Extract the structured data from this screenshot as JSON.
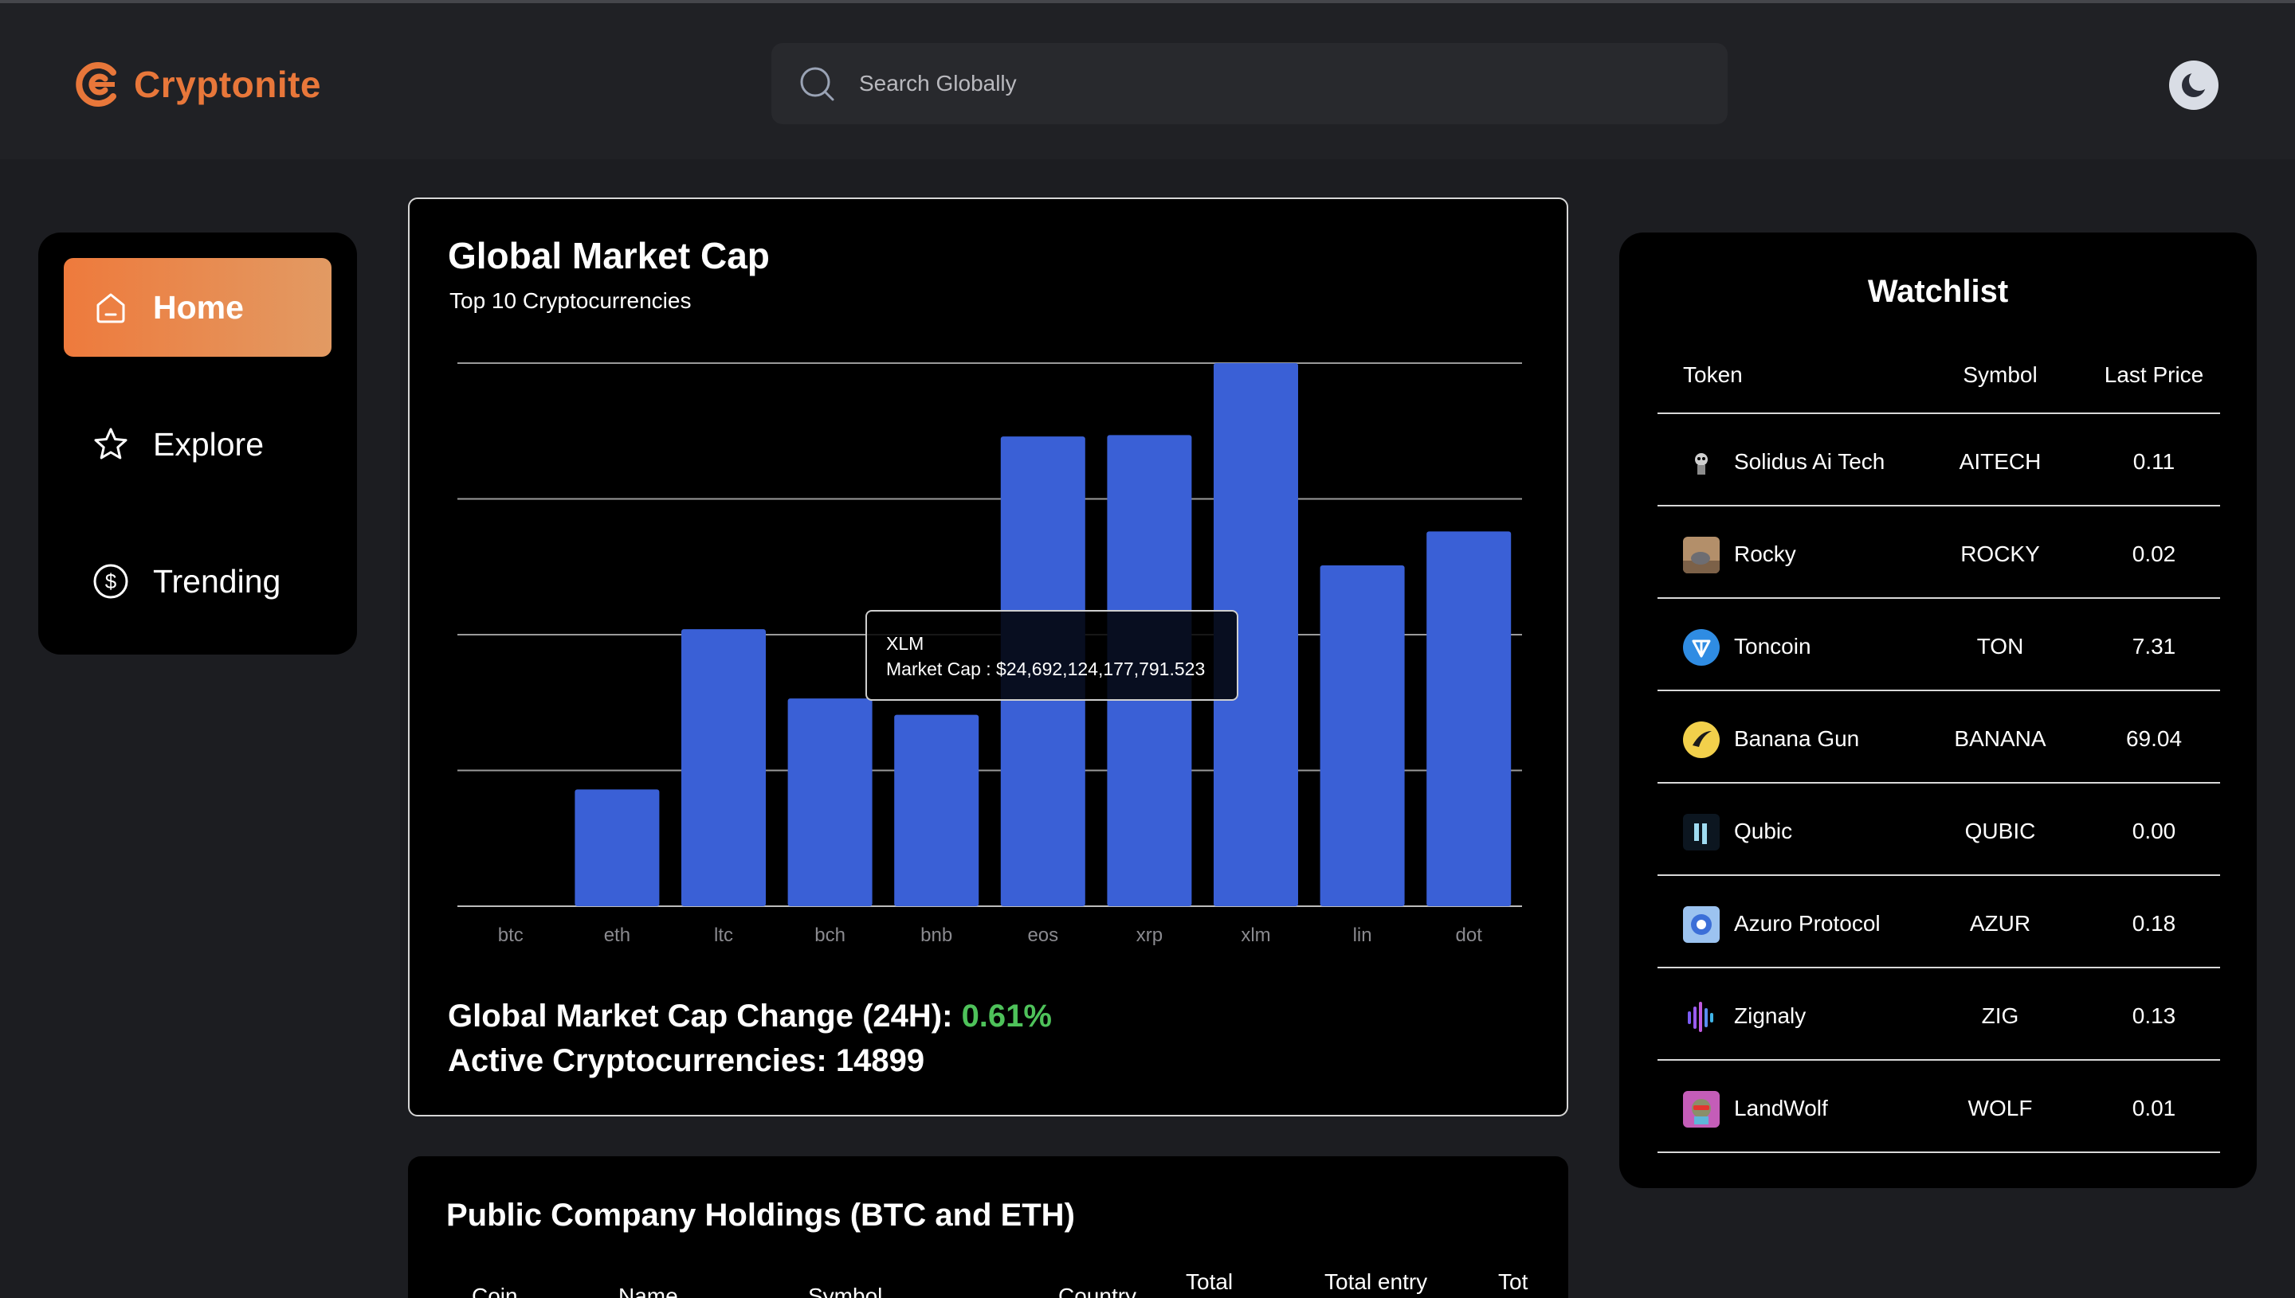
{
  "header": {
    "brand": "Cryptonite",
    "search_placeholder": "Search Globally"
  },
  "sidebar": {
    "items": [
      {
        "label": "Home",
        "icon": "home-icon",
        "active": true
      },
      {
        "label": "Explore",
        "icon": "star-icon",
        "active": false
      },
      {
        "label": "Trending",
        "icon": "dollar-circle-icon",
        "active": false
      }
    ]
  },
  "global_market": {
    "title": "Global Market Cap",
    "subtitle": "Top 10 Cryptocurrencies",
    "tooltip": {
      "name": "XLM",
      "label": "Market Cap : $24,692,124,177,791.523"
    },
    "change_label": "Global Market Cap Change (24H):",
    "change_value": "0.61%",
    "active_label": "Active Cryptocurrencies:",
    "active_value": "14899"
  },
  "chart_data": {
    "type": "bar",
    "categories": [
      "btc",
      "eth",
      "ltc",
      "bch",
      "bnb",
      "eos",
      "xrp",
      "xlm",
      "lin",
      "dot"
    ],
    "values": [
      0,
      0.86,
      2.04,
      1.53,
      1.41,
      3.46,
      3.47,
      4.0,
      2.51,
      2.76
    ],
    "ylim": [
      0,
      4
    ],
    "grid": true,
    "bar_color": "#3a60d6"
  },
  "watchlist": {
    "title": "Watchlist",
    "columns": [
      "Token",
      "Symbol",
      "Last Price"
    ],
    "rows": [
      {
        "name": "Solidus Ai Tech",
        "symbol": "AITECH",
        "price": "0.11",
        "icon": "solidus-icon"
      },
      {
        "name": "Rocky",
        "symbol": "ROCKY",
        "price": "0.02",
        "icon": "rocky-icon"
      },
      {
        "name": "Toncoin",
        "symbol": "TON",
        "price": "7.31",
        "icon": "toncoin-icon"
      },
      {
        "name": "Banana Gun",
        "symbol": "BANANA",
        "price": "69.04",
        "icon": "banana-icon"
      },
      {
        "name": "Qubic",
        "symbol": "QUBIC",
        "price": "0.00",
        "icon": "qubic-icon"
      },
      {
        "name": "Azuro Protocol",
        "symbol": "AZUR",
        "price": "0.18",
        "icon": "azuro-icon"
      },
      {
        "name": "Zignaly",
        "symbol": "ZIG",
        "price": "0.13",
        "icon": "zignaly-icon"
      },
      {
        "name": "LandWolf",
        "symbol": "WOLF",
        "price": "0.01",
        "icon": "landwolf-icon"
      }
    ]
  },
  "holdings": {
    "title": "Public Company Holdings (BTC and ETH)",
    "columns": [
      "Coin",
      "Name",
      "Symbol",
      "Country",
      "Total",
      "Total entry",
      "Tot"
    ]
  },
  "colors": {
    "accent": "#e8773a",
    "positive": "#4ec25a",
    "bar": "#3a60d6"
  }
}
